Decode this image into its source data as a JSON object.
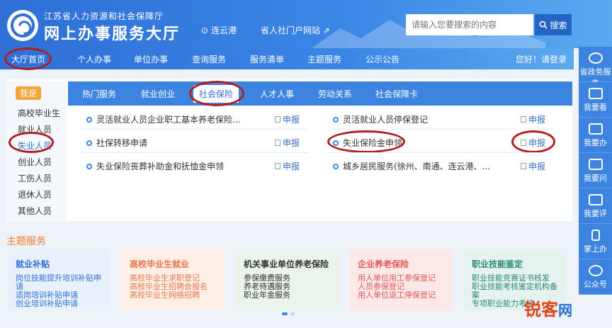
{
  "header": {
    "org": "江苏省人力资源和社会保障厅",
    "site_name": "网上办事服务大厅",
    "location": "连云港",
    "portal_link": "省人社门户网站",
    "search_placeholder": "请输入您要搜索的内容",
    "search_button": "搜索"
  },
  "nav": {
    "items": [
      "大厅首页",
      "个人办事",
      "单位办事",
      "查询服务",
      "服务清单",
      "主题服务",
      "公示公告"
    ],
    "greeting": "您好！请登录"
  },
  "sidebar": {
    "title": "我是",
    "items": [
      "高校毕业生",
      "就业人员",
      "失业人员",
      "创业人员",
      "工伤人员",
      "退休人员",
      "其他人员"
    ]
  },
  "tabs": [
    "热门服务",
    "就业创业",
    "社会保险",
    "人才人事",
    "劳动关系",
    "社会保障卡"
  ],
  "services": [
    {
      "name": "灵活就业人员企业职工基本养老保险...",
      "action": "申报"
    },
    {
      "name": "灵活就业人员停保登记",
      "action": "申报"
    },
    {
      "name": "社保转移申请",
      "action": "申报"
    },
    {
      "name": "失业保险金申领",
      "action": "申报"
    },
    {
      "name": "失业保险丧葬补助金和抚恤金申领",
      "action": "申报"
    },
    {
      "name": "城乡居民服务(徐州、南通、连云港、...",
      "action": "申报"
    }
  ],
  "themes": {
    "title": "主题服务",
    "cards": [
      {
        "title": "就业补贴",
        "lines": [
          "岗位技能提升培训补贴申",
          "请",
          "适岗培训补贴申请",
          "创业培训补贴申请"
        ],
        "bg": "#e8f1fb",
        "color": "#2f6fd6"
      },
      {
        "title": "高校毕业生就业",
        "lines": [
          "高校毕业生求职登记",
          "高校毕业生招聘会报名",
          "高校毕业生网络招聘"
        ],
        "bg": "#fdeee6",
        "color": "#e9754d"
      },
      {
        "title": "机关事业单位养老保险",
        "lines": [
          "参保缴费服务",
          "养老待遇服务",
          "职业年金服务"
        ],
        "bg": "#eaf3ec",
        "color": "#333333"
      },
      {
        "title": "企业养老保险",
        "lines": [
          "用人单位用工参保登记",
          "人员参保登记",
          "用人单位退工停保登记"
        ],
        "bg": "#fde8e8",
        "color": "#e05555"
      },
      {
        "title": "职业技能鉴定",
        "lines": [
          "职业技能竞赛证书核发",
          "职业技能考核鉴定机构备",
          "案",
          "专项职业能力考核"
        ],
        "bg": "#e6f2ef",
        "color": "#2a8a76"
      }
    ]
  },
  "right_toolbar": [
    "省政务服务",
    "我要看",
    "我要办",
    "我要问",
    "我要评",
    "掌上办",
    "公众号"
  ],
  "watermark": {
    "main": "锐客",
    "suffix": "网"
  }
}
